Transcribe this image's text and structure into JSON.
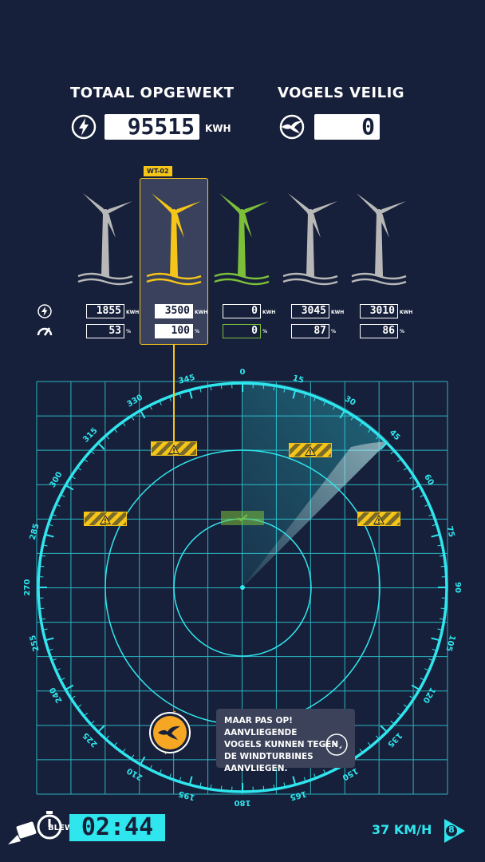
{
  "header": {
    "total_label": "TOTAAL OPGEWEKT",
    "total_value": "95515",
    "total_unit": "KWH",
    "birds_label": "VOGELS VEILIG",
    "birds_value": "0"
  },
  "turbines": {
    "selected_tag": "WT-02",
    "items": [
      {
        "color": "#b8b8b8",
        "power": "1855",
        "power_unit": "KWH",
        "efficiency": "53",
        "eff_unit": "%"
      },
      {
        "color": "#f5c518",
        "power": "3500",
        "power_unit": "KWH",
        "efficiency": "100",
        "eff_unit": "%"
      },
      {
        "color": "#7cc03a",
        "power": "0",
        "power_unit": "KWH",
        "efficiency": "0",
        "eff_unit": "%"
      },
      {
        "color": "#b8b8b8",
        "power": "3045",
        "power_unit": "KWH",
        "efficiency": "87",
        "eff_unit": "%"
      },
      {
        "color": "#b8b8b8",
        "power": "3010",
        "power_unit": "KWH",
        "efficiency": "86",
        "eff_unit": "%"
      }
    ]
  },
  "radar": {
    "compass_labels": [
      "0",
      "15",
      "30",
      "45",
      "60",
      "75",
      "90",
      "105",
      "120",
      "135",
      "150",
      "165",
      "180",
      "195",
      "210",
      "225",
      "240",
      "255",
      "270",
      "285",
      "300",
      "315",
      "330",
      "345"
    ],
    "accent_color": "#2fe6ee"
  },
  "tooltip": {
    "line1": "MAAR PAS OP! AANVLIEGENDE",
    "line2": "VOGELS KUNNEN TEGEN",
    "line3": "DE WINDTURBINES",
    "line4": "AANVLIEGEN."
  },
  "footer": {
    "timer": "02:44",
    "watermark": "BLEWSCREEN",
    "wind_speed": "37 KM/H",
    "wind_badge": "8"
  },
  "icons": {
    "power": "lightning-icon",
    "efficiency": "gauge-icon",
    "bird": "bird-icon",
    "stopwatch": "stopwatch-icon",
    "wind": "wind-direction-icon"
  }
}
